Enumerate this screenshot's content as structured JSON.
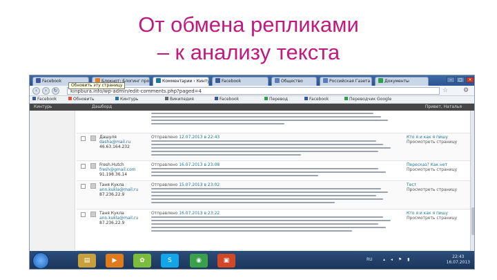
{
  "slide": {
    "title_line1": "От обмена репликами",
    "title_line2": "– к анализу текста"
  },
  "browser": {
    "tabs": [
      {
        "label": "Facebook",
        "active": false,
        "color": "#3b5998"
      },
      {
        "label": "Блокнот: Блогинг проект",
        "active": false,
        "color": "#e67e22"
      },
      {
        "label": "Комментарии ‹ Кинтурь",
        "active": true,
        "color": "#21759b"
      },
      {
        "label": "Facebook",
        "active": false,
        "color": "#3b5998"
      },
      {
        "label": "Общество",
        "active": false,
        "color": "#5b7fb5"
      },
      {
        "label": "Российская Газета",
        "active": false,
        "color": "#5b7fb5"
      },
      {
        "label": "Документы",
        "active": false,
        "color": "#2e9e4f"
      }
    ],
    "address": "kinpbura.info/wp-admin/edit-comments.php?paged=4",
    "tooltip": "Обновить эту страницу",
    "bookmarks": [
      "Facebook",
      "Обновить",
      "Кинтурь",
      "Википедия",
      "Facebook",
      "Перевод",
      "Facebook",
      "Переводчик Google"
    ]
  },
  "wp": {
    "site": "Кинтурь",
    "menu": "Дашборд",
    "howdy": "Привет, Наталья"
  },
  "comments": [
    {
      "author": "",
      "email": "",
      "ip": "",
      "submitted": "",
      "date": "",
      "response": "",
      "lines": 4
    },
    {
      "author": "Дашуля",
      "email": "dasha@mail.ru",
      "ip": "46.63.164.232",
      "submitted": "Отправлено",
      "date": "12.07.2013 в 22:43",
      "response": "Кто я и как я пишу",
      "response_sub": "Просмотреть страницу",
      "lines": 5
    },
    {
      "author": "Fresh.Hutch",
      "email": "fresh@gmail.com",
      "ip": "91.198.36.14",
      "submitted": "Отправлено",
      "date": "16.07.2013 в 23:08",
      "response": "Пересказ? Как нет",
      "response_sub": "Просмотреть страницу",
      "lines": 3
    },
    {
      "author": "Таня Кукла",
      "email": "ann.kukla@mail.ru",
      "ip": "87.236.22.9",
      "submitted": "Отправлено",
      "date": "15.07.2013 в 23:02",
      "response": "Тест",
      "response_sub": "Просмотреть страницу",
      "lines": 5
    },
    {
      "author": "Таня Кукла",
      "email": "ann.kukla@mail.ru",
      "ip": "87.236.22.9",
      "submitted": "Отправлено",
      "date": "16.07.2013 в 23:22",
      "response": "Кто я и как я пишу",
      "response_sub": "Просмотреть страницу",
      "lines": 5
    }
  ],
  "taskbar": {
    "apps": [
      {
        "name": "explorer",
        "glyph": "▤",
        "color": "#c9a13b"
      },
      {
        "name": "media",
        "glyph": "▶",
        "color": "#e07b1b"
      },
      {
        "name": "icq",
        "glyph": "✿",
        "color": "#7dbb3a"
      },
      {
        "name": "skype",
        "glyph": "S",
        "color": "#12a5e8"
      },
      {
        "name": "chrome",
        "glyph": "◉",
        "color": "#3aa04a"
      },
      {
        "name": "office",
        "glyph": "▣",
        "color": "#d24726"
      }
    ],
    "lang": "RU",
    "time": "22:43",
    "date": "16.07.2013"
  }
}
